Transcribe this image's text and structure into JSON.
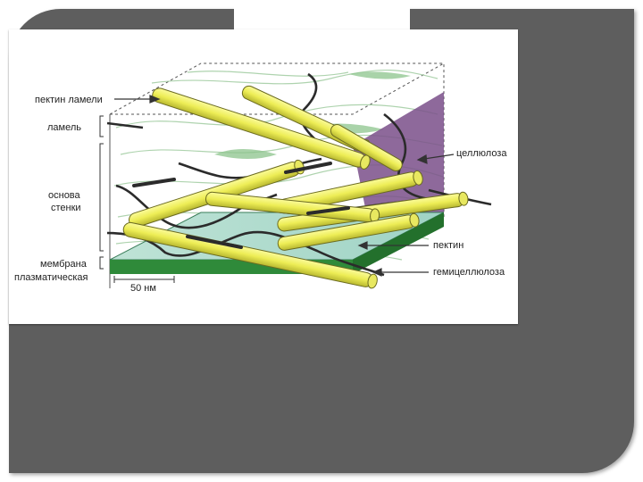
{
  "labels": {
    "pectin_lamella": "пектин ламели",
    "lamella": "ламель",
    "wall_base_line1": "основа",
    "wall_base_line2": "стенки",
    "membrane_line1": "мембрана",
    "membrane_line2": "плазматическая",
    "cellulose": "целлюлоза",
    "pectin": "пектин",
    "hemicellulose": "гемицеллюлоза",
    "scale": "50 нм"
  },
  "colors": {
    "panel": "#5e5e5e",
    "cellulose_fibril": "#f0f060",
    "pectin_band": "#7a4f8a",
    "membrane": "#2f8a3a",
    "matrix": "#cfe6cf"
  }
}
